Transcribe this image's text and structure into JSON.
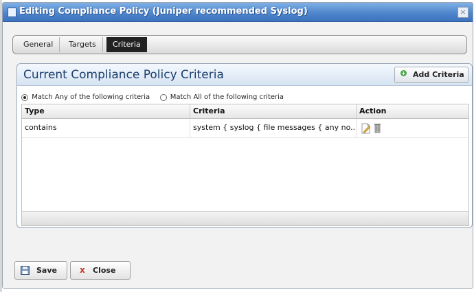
{
  "window": {
    "title": "Editing Compliance Policy (Juniper recommended Syslog)",
    "close_glyph": "×"
  },
  "tabs": [
    {
      "label": "General"
    },
    {
      "label": "Targets"
    },
    {
      "label": "Criteria",
      "active": true
    }
  ],
  "panel": {
    "title": "Current Compliance Policy Criteria",
    "add_button": "Add Criteria",
    "match_any": "Match Any of the following criteria",
    "match_all": "Match All of the following criteria",
    "selected_match": "any"
  },
  "grid": {
    "columns": [
      "Type",
      "Criteria",
      "Action"
    ],
    "rows": [
      {
        "type": "contains",
        "criteria": "system { syslog { file messages { any no..."
      }
    ]
  },
  "buttons": {
    "save": "Save",
    "close": "Close",
    "close_glyph": "x"
  },
  "colors": {
    "title_bar": "#4f86cc",
    "panel_title": "#1c3f6e",
    "add_icon": "#4aa84a",
    "close_icon": "#c0392b"
  }
}
